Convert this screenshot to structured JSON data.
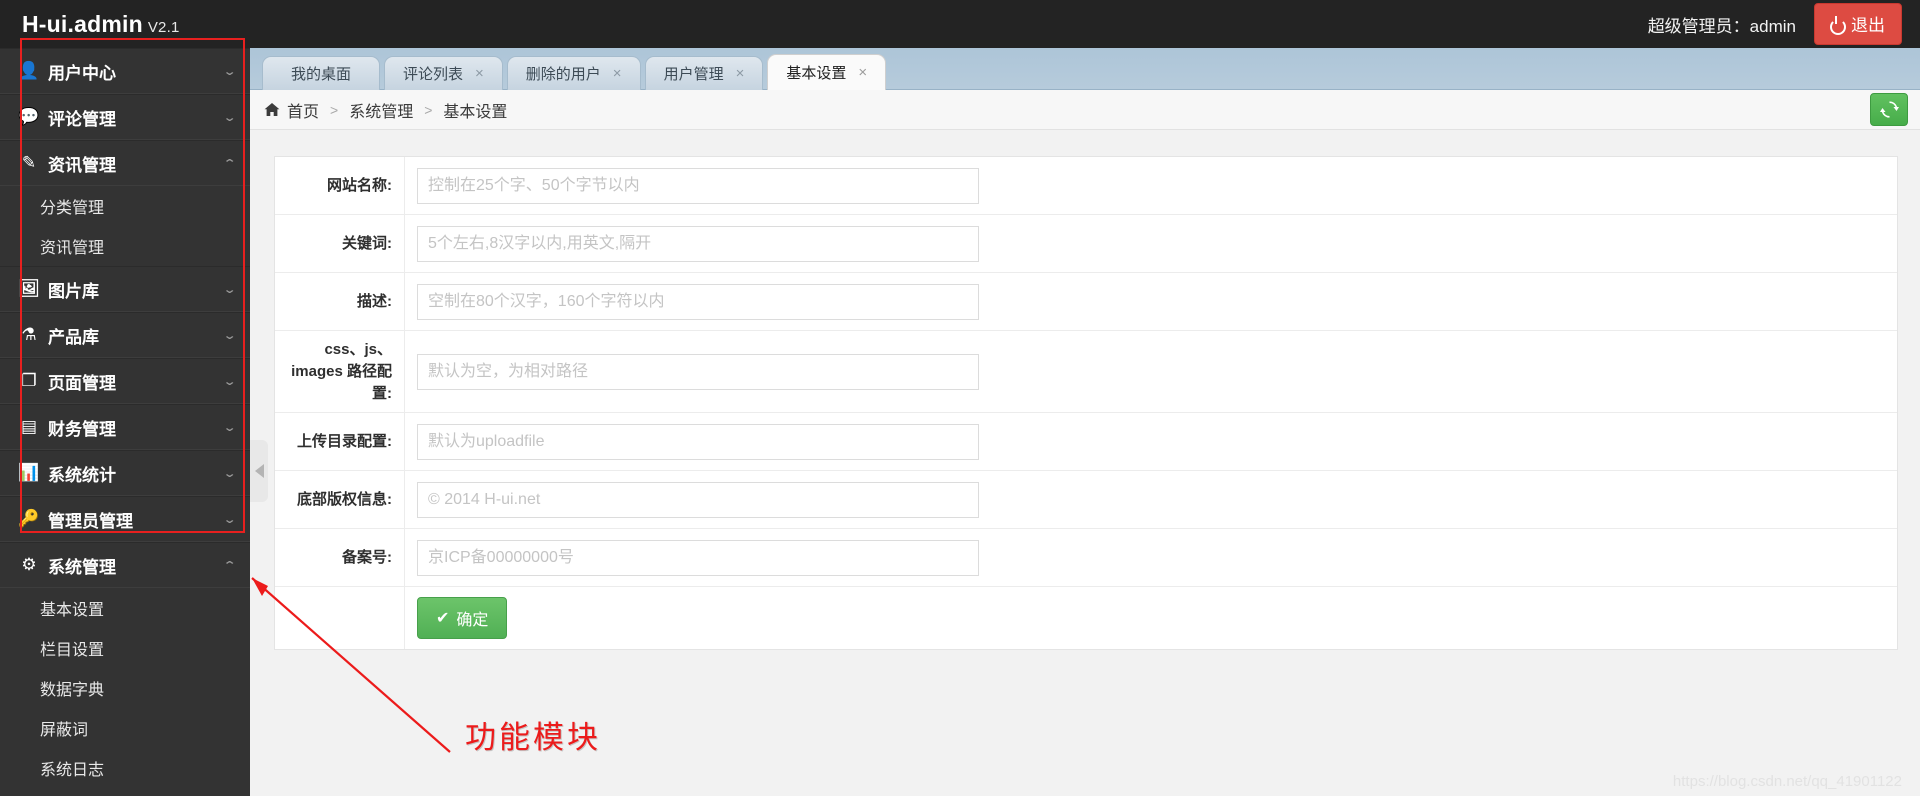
{
  "topbar": {
    "brand_name": "H-ui.admin",
    "brand_version": "V2.1",
    "admin_label": "超级管理员：admin",
    "logout_label": "退出",
    "power_icon": "power-icon"
  },
  "sidebar": {
    "items": [
      {
        "label": "用户中心",
        "icon": "user-icon",
        "glyph": "👤",
        "expanded": false,
        "children": []
      },
      {
        "label": "评论管理",
        "icon": "comment-icon",
        "glyph": "💬",
        "expanded": false,
        "children": []
      },
      {
        "label": "资讯管理",
        "icon": "edit-square-icon",
        "glyph": "✎",
        "expanded": true,
        "children": [
          "分类管理",
          "资讯管理"
        ]
      },
      {
        "label": "图片库",
        "icon": "image-icon",
        "glyph": "🖼",
        "expanded": false,
        "children": []
      },
      {
        "label": "产品库",
        "icon": "flask-icon",
        "glyph": "⚗",
        "expanded": false,
        "children": []
      },
      {
        "label": "页面管理",
        "icon": "copy-page-icon",
        "glyph": "❐",
        "expanded": false,
        "children": []
      },
      {
        "label": "财务管理",
        "icon": "money-card-icon",
        "glyph": "▤",
        "expanded": false,
        "children": []
      },
      {
        "label": "系统统计",
        "icon": "bar-chart-icon",
        "glyph": "📊",
        "expanded": false,
        "children": []
      },
      {
        "label": "管理员管理",
        "icon": "key-icon",
        "glyph": "🔑",
        "expanded": false,
        "children": []
      },
      {
        "label": "系统管理",
        "icon": "gears-icon",
        "glyph": "⚙",
        "expanded": true,
        "children": [
          "基本设置",
          "栏目设置",
          "数据字典",
          "屏蔽词",
          "系统日志"
        ]
      }
    ],
    "caret_down": "⌄",
    "caret_up": "⌃",
    "collapse_handle_icon": "chevron-left-icon"
  },
  "tabs": [
    {
      "label": "我的桌面",
      "closable": false,
      "active": false
    },
    {
      "label": "评论列表",
      "closable": true,
      "active": false
    },
    {
      "label": "删除的用户",
      "closable": true,
      "active": false
    },
    {
      "label": "用户管理",
      "closable": true,
      "active": false
    },
    {
      "label": "基本设置",
      "closable": true,
      "active": true
    }
  ],
  "tab_close_glyph": "×",
  "breadcrumb": {
    "home_icon": "home-icon",
    "items": [
      "首页",
      "系统管理",
      "基本设置"
    ],
    "separator": ">",
    "refresh_icon": "refresh-icon"
  },
  "form": {
    "rows": [
      {
        "label": "网站名称:",
        "placeholder": "控制在25个字、50个字节以内",
        "value": "",
        "name": "site-name"
      },
      {
        "label": "关键词:",
        "placeholder": "5个左右,8汉字以内,用英文,隔开",
        "value": "",
        "name": "keywords"
      },
      {
        "label": "描述:",
        "placeholder": "空制在80个汉字，160个字符以内",
        "value": "",
        "name": "description"
      },
      {
        "label": "css、js、images 路径配置:",
        "placeholder": "默认为空，为相对路径",
        "value": "",
        "name": "assets-path"
      },
      {
        "label": "上传目录配置:",
        "placeholder": "默认为uploadfile",
        "value": "",
        "name": "upload-dir"
      },
      {
        "label": "底部版权信息:",
        "placeholder": "© 2014 H-ui.net",
        "value": "",
        "name": "copyright"
      },
      {
        "label": "备案号:",
        "placeholder": "京ICP备00000000号",
        "value": "",
        "name": "icp-number"
      }
    ],
    "submit_label": "确定",
    "submit_check_glyph": "✔"
  },
  "annotation": {
    "label": "功能模块",
    "color": "#ec1b1b"
  },
  "watermark": "https://blog.csdn.net/qq_41901122",
  "colors": {
    "topbar_bg": "#232323",
    "sidebar_bg": "#333333",
    "accent_red": "#dd4b42",
    "accent_green": "#51b055",
    "tabstrip_bg": "#b6cbdb",
    "annotation_red": "#ec1b1b"
  }
}
